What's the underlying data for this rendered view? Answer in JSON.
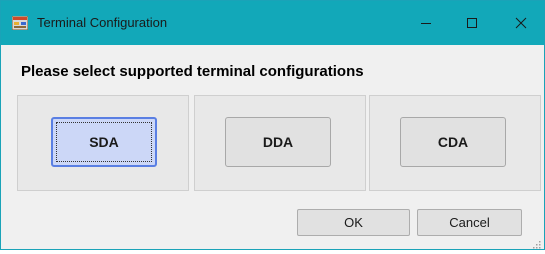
{
  "window": {
    "title": "Terminal Configuration",
    "accent_color": "#12a8b9"
  },
  "titlebar_icons": {
    "app": "app-icon",
    "minimize": "minimize-icon",
    "maximize": "maximize-icon",
    "close": "close-icon"
  },
  "heading": "Please select supported terminal configurations",
  "options": [
    {
      "label": "SDA",
      "selected": true
    },
    {
      "label": "DDA",
      "selected": false
    },
    {
      "label": "CDA",
      "selected": false
    }
  ],
  "buttons": {
    "ok": "OK",
    "cancel": "Cancel"
  }
}
